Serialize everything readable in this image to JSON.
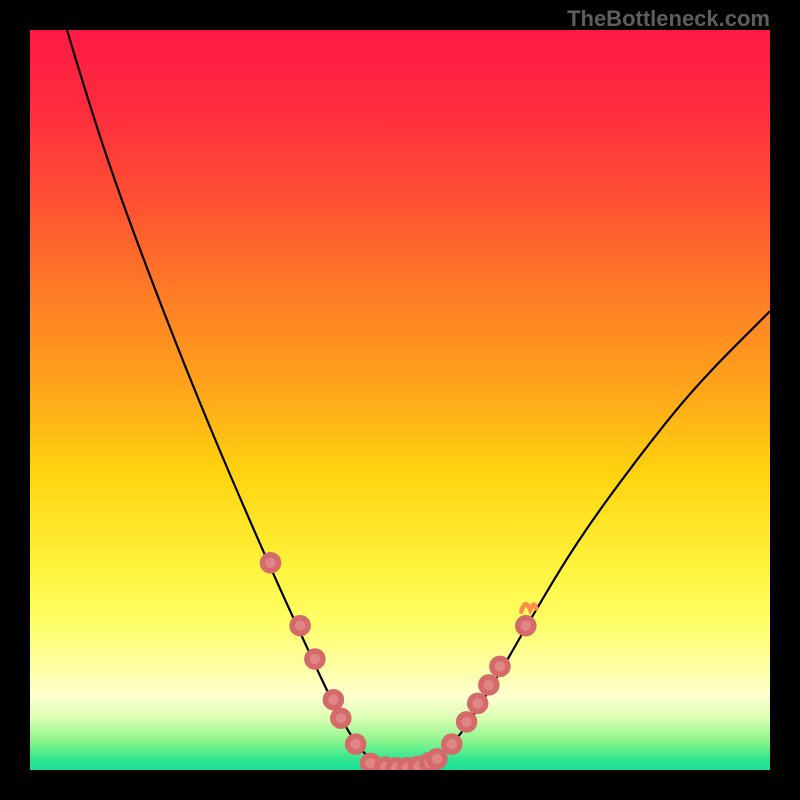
{
  "watermark": "TheBottleneck.com",
  "chart_data": {
    "type": "line",
    "title": "",
    "xlabel": "",
    "ylabel": "",
    "xlim": [
      0,
      100
    ],
    "ylim": [
      0,
      100
    ],
    "grid": false,
    "legend": false,
    "background_gradient_stops": [
      {
        "offset": 0.0,
        "color": "#ff1a44"
      },
      {
        "offset": 0.1,
        "color": "#ff2b3f"
      },
      {
        "offset": 0.22,
        "color": "#ff4d33"
      },
      {
        "offset": 0.35,
        "color": "#ff7a26"
      },
      {
        "offset": 0.48,
        "color": "#ffa31a"
      },
      {
        "offset": 0.6,
        "color": "#ffd40f"
      },
      {
        "offset": 0.72,
        "color": "#fff23a"
      },
      {
        "offset": 0.8,
        "color": "#ffff66"
      },
      {
        "offset": 0.86,
        "color": "#ffffa3"
      },
      {
        "offset": 0.9,
        "color": "#ffffd0"
      },
      {
        "offset": 0.93,
        "color": "#d9ffb3"
      },
      {
        "offset": 0.96,
        "color": "#8cf58c"
      },
      {
        "offset": 0.985,
        "color": "#33e690"
      },
      {
        "offset": 1.0,
        "color": "#1adf99"
      }
    ],
    "series": [
      {
        "name": "bottleneck-curve",
        "stroke": "#000000",
        "stroke_width": 2.2,
        "points": [
          {
            "x": 5.0,
            "y": 100.0
          },
          {
            "x": 8.0,
            "y": 90.0
          },
          {
            "x": 12.0,
            "y": 78.0
          },
          {
            "x": 18.0,
            "y": 62.0
          },
          {
            "x": 24.0,
            "y": 47.0
          },
          {
            "x": 30.0,
            "y": 33.0
          },
          {
            "x": 34.0,
            "y": 24.0
          },
          {
            "x": 37.0,
            "y": 17.5
          },
          {
            "x": 40.0,
            "y": 11.0
          },
          {
            "x": 42.5,
            "y": 6.0
          },
          {
            "x": 45.0,
            "y": 2.3
          },
          {
            "x": 47.0,
            "y": 0.8
          },
          {
            "x": 49.0,
            "y": 0.3
          },
          {
            "x": 51.0,
            "y": 0.3
          },
          {
            "x": 53.0,
            "y": 0.6
          },
          {
            "x": 55.0,
            "y": 1.5
          },
          {
            "x": 58.0,
            "y": 4.5
          },
          {
            "x": 61.0,
            "y": 9.0
          },
          {
            "x": 64.0,
            "y": 14.0
          },
          {
            "x": 68.0,
            "y": 21.0
          },
          {
            "x": 74.0,
            "y": 31.0
          },
          {
            "x": 82.0,
            "y": 42.0
          },
          {
            "x": 90.0,
            "y": 52.0
          },
          {
            "x": 100.0,
            "y": 62.0
          }
        ]
      }
    ],
    "markers": {
      "stroke": "#d46a6a",
      "stroke_width": 5.5,
      "fill": "#e08585",
      "radius": 8,
      "left_branch": [
        {
          "x": 32.5,
          "y": 28.0
        },
        {
          "x": 36.5,
          "y": 19.5
        },
        {
          "x": 38.5,
          "y": 15.0
        },
        {
          "x": 41.0,
          "y": 9.5
        },
        {
          "x": 42.0,
          "y": 7.0
        },
        {
          "x": 44.0,
          "y": 3.5
        }
      ],
      "bottom": [
        {
          "x": 46.0,
          "y": 0.9
        },
        {
          "x": 48.0,
          "y": 0.4
        },
        {
          "x": 49.5,
          "y": 0.3
        },
        {
          "x": 51.0,
          "y": 0.3
        },
        {
          "x": 52.5,
          "y": 0.5
        },
        {
          "x": 54.0,
          "y": 1.0
        },
        {
          "x": 55.0,
          "y": 1.5
        }
      ],
      "right_branch": [
        {
          "x": 57.0,
          "y": 3.5
        },
        {
          "x": 59.0,
          "y": 6.5
        },
        {
          "x": 60.5,
          "y": 9.0
        },
        {
          "x": 62.0,
          "y": 11.5
        },
        {
          "x": 63.5,
          "y": 14.0
        },
        {
          "x": 67.0,
          "y": 19.5
        }
      ]
    },
    "accent_at_right_cluster_top": {
      "x": 67.2,
      "y": 22.2,
      "color": "#ff8d4a"
    }
  }
}
